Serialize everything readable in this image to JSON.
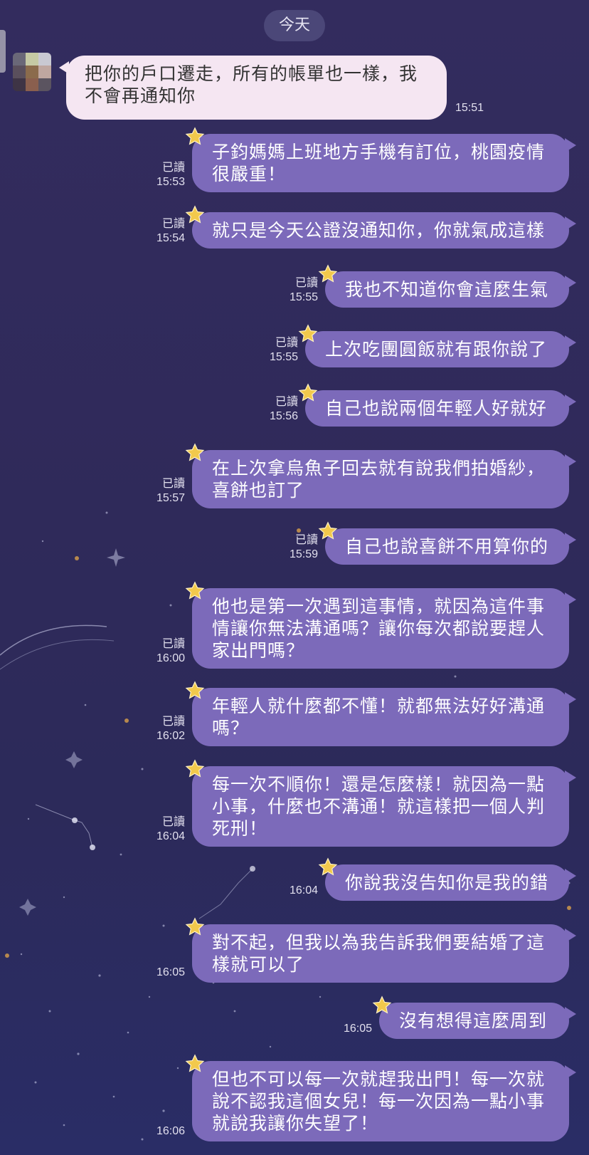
{
  "date_label": "今天",
  "incoming": {
    "text_lines": [
      "把你的戶口遷走，所有的帳單也一樣，我",
      "不會再通知你"
    ],
    "time": "15:51"
  },
  "read_label": "已讀",
  "messages": [
    {
      "lines": [
        "子鈞媽媽上班地方手機有訂位，桃園疫情",
        "很嚴重！"
      ],
      "read": true,
      "time": "15:53"
    },
    {
      "lines": [
        "就只是今天公證沒通知你，你就氣成這樣"
      ],
      "read": true,
      "time": "15:54"
    },
    {
      "lines": [
        "我也不知道你會這麼生氣"
      ],
      "read": true,
      "time": "15:55"
    },
    {
      "lines": [
        "上次吃團圓飯就有跟你說了"
      ],
      "read": true,
      "time": "15:55"
    },
    {
      "lines": [
        "自己也說兩個年輕人好就好"
      ],
      "read": true,
      "time": "15:56"
    },
    {
      "lines": [
        "在上次拿烏魚子回去就有說我們拍婚紗，",
        "喜餅也訂了"
      ],
      "read": true,
      "time": "15:57"
    },
    {
      "lines": [
        "自己也說喜餅不用算你的"
      ],
      "read": true,
      "time": "15:59"
    },
    {
      "lines": [
        "他也是第一次遇到這事情，就因為這件事",
        "情讓你無法溝通嗎？讓你每次都說要趕人",
        "家出門嗎？"
      ],
      "read": true,
      "time": "16:00"
    },
    {
      "lines": [
        "年輕人就什麼都不懂！就都無法好好溝通",
        "嗎？"
      ],
      "read": true,
      "time": "16:02"
    },
    {
      "lines": [
        "每一次不順你！還是怎麼樣！就因為一點",
        "小事，什麼也不溝通！就這樣把一個人判",
        "死刑！"
      ],
      "read": true,
      "time": "16:04"
    },
    {
      "lines": [
        "你說我沒告知你是我的錯"
      ],
      "read": false,
      "time": "16:04"
    },
    {
      "lines": [
        "對不起，但我以為我告訴我們要結婚了這",
        "樣就可以了"
      ],
      "read": false,
      "time": "16:05"
    },
    {
      "lines": [
        "沒有想得這麼周到"
      ],
      "read": false,
      "time": "16:05"
    },
    {
      "lines": [
        "但也不可以每一次就趕我出門！每一次就",
        "說不認我這個女兒！每一次因為一點小事",
        "就說我讓你失望了！"
      ],
      "read": false,
      "time": "16:06"
    }
  ],
  "icons": {
    "bubble_decoration": "star-icon",
    "avatar": "avatar-image"
  },
  "colors": {
    "outgoing_bubble": "#7c6aba",
    "incoming_bubble": "#f5e6f2",
    "background": "#2f2a5a",
    "star": "#f2c94c"
  }
}
